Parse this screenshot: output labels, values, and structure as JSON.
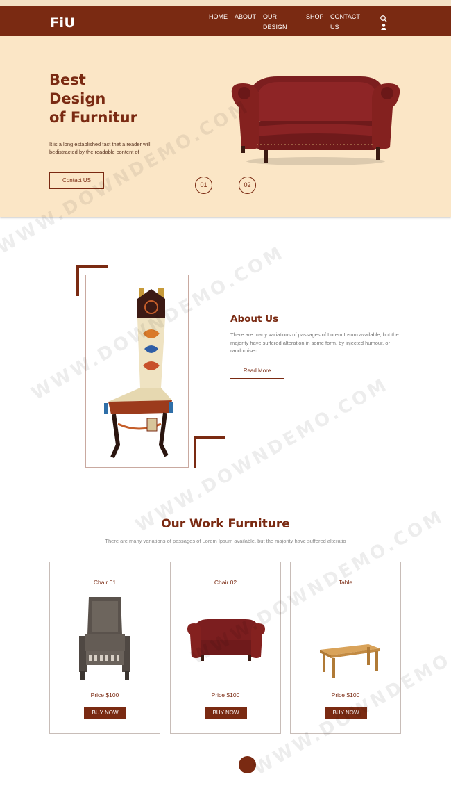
{
  "nav": {
    "logo": "FiU",
    "links": [
      "HOME",
      "ABOUT",
      "OUR DESIGN",
      "SHOP",
      "CONTACT US"
    ],
    "search_icon": "search-icon",
    "user_icon": "user-icon"
  },
  "hero": {
    "title_lines": [
      "Best",
      "Design",
      "of Furnitur"
    ],
    "text": "It is a long established fact that a reader will bedistracted by the readable content of",
    "button": "Contact US",
    "slides": [
      "01",
      "02"
    ]
  },
  "about": {
    "title": "About Us",
    "text": "There are many variations of passages of Lorem Ipsum available, but the majority have suffered alteration in some form, by injected humour, or randomised",
    "button": "Read More"
  },
  "work": {
    "title": "Our Work Furniture",
    "subtitle": "There are many variations of passages of Lorem Ipsum available, but the majority have suffered alteratio",
    "cards": [
      {
        "name": "Chair 01",
        "price": "Price $100",
        "button": "BUY NOW"
      },
      {
        "name": "Chair 02",
        "price": "Price $100",
        "button": "BUY NOW"
      },
      {
        "name": "Table",
        "price": "Price $100",
        "button": "BUY NOW"
      }
    ]
  },
  "watermark": "WWW.DOWNDEMO.COM",
  "colors": {
    "brand": "#7a2a12",
    "hero_bg": "#fbe6c6",
    "top_strip": "#f3e1c5"
  }
}
